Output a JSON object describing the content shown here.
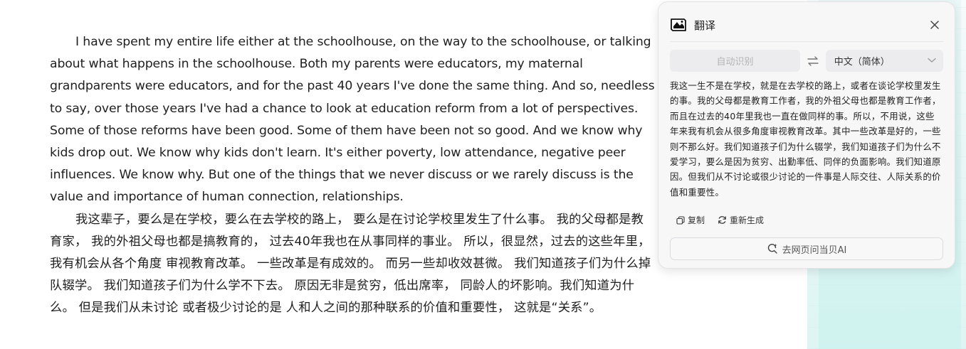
{
  "article": {
    "paragraph_en": "I have spent my entire life either at the schoolhouse, on the way to the schoolhouse, or talking about what happens in the schoolhouse. Both my parents were educators, my maternal grandparents were educators, and for the past 40 years I've done the same thing. And so, needless to say, over those years I've had a chance to look at education reform from a lot of perspectives. Some of those reforms have been good. Some of them have been not so good. And we know why kids drop out. We know why kids don't learn. It's either poverty, low attendance, negative peer influences. We know why. But one of the things that we never discuss or we rarely discuss is the value and importance of human connection, relationships.",
    "paragraph_zh": "我这辈子，要么是在学校，要么在去学校的路上， 要么是在讨论学校里发生了什么事。 我的父母都是教育家， 我的外祖父母也都是搞教育的， 过去40年我也在从事同样的事业。 所以，很显然，过去的这些年里， 我有机会从各个角度 审视教育改革。 一些改革是有成效的。 而另一些却收效甚微。 我们知道孩子们为什么掉队辍学。 我们知道孩子们为什么学不下去。 原因无非是贫穷，低出席率， 同龄人的坏影响。我们知道为什么。 但是我们从未讨论 或者极少讨论的是 人和人之间的那种联系的价值和重要性， 这就是“关系”。"
  },
  "panel": {
    "title": "翻译",
    "source_lang": "自动识别",
    "target_lang": "中文（简体）",
    "translation": "我这一生不是在学校，就是在去学校的路上，或者在谈论学校里发生的事。我的父母都是教育工作者，我的外祖父母也都是教育工作者，而且在过去的40年里我也一直在做同样的事。所以，不用说，这些年来我有机会从很多角度审视教育改革。其中一些改革是好的，一些则不那么好。我们知道孩子们为什么辍学，我们知道孩子们为什么不爱学习，要么是因为贫穷、出勤率低、同伴的负面影响。我们知道原因。但我们从不讨论或很少讨论的一件事是人际交往、人际关系的价值和重要性。",
    "copy_label": "复制",
    "regenerate_label": "重新生成",
    "ask_label": "去网页问当贝AI"
  },
  "icons": {
    "logo": "translate-logo-icon",
    "close": "close-icon",
    "swap": "swap-icon",
    "chevron": "chevron-down-icon",
    "copy": "copy-icon",
    "regenerate": "refresh-icon",
    "ask": "ai-search-icon"
  },
  "colors": {
    "panel_bg": "#f7f7f8",
    "text": "#1f1f1f",
    "muted": "#b4b4b8",
    "page_accent": "#ddf5f3"
  }
}
